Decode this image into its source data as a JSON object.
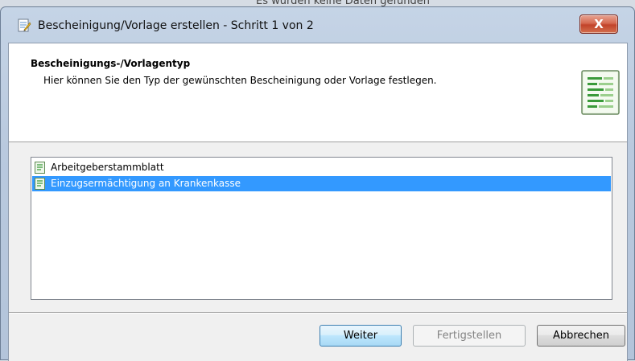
{
  "background": {
    "partial_text": "Es wurden keine Daten gefunden"
  },
  "window": {
    "title": "Bescheinigung/Vorlage erstellen - Schritt 1 von 2",
    "close_label": "X"
  },
  "header": {
    "title": "Bescheinigungs-/Vorlagentyp",
    "description": "Hier können Sie den Typ der gewünschten Bescheinigung oder Vorlage festlegen.",
    "icon": "document-list-icon"
  },
  "list": {
    "items": [
      {
        "label": "Arbeitgeberstammblatt",
        "icon": "document-icon",
        "selected": false
      },
      {
        "label": "Einzugsermächtigung an Krankenkasse",
        "icon": "document-icon",
        "selected": true
      }
    ]
  },
  "buttons": {
    "next": "Weiter",
    "finish": "Fertigstellen",
    "cancel": "Abbrechen"
  },
  "colors": {
    "selection": "#3399ff",
    "close_button": "#c2432a"
  }
}
